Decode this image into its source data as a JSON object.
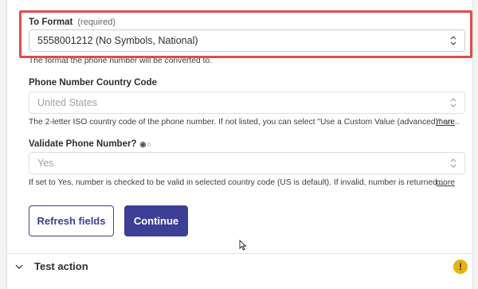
{
  "to_format": {
    "label": "To Format",
    "required": "(required)",
    "value": "5558001212 (No Symbols, National)",
    "help": "The format the phone number will be converted to."
  },
  "country_code": {
    "label": "Phone Number Country Code",
    "value": "United States",
    "help": "The 2-letter ISO country code of the phone number. If not listed, you can select \"Use a Custom Value (advanced)\" an...",
    "more": "more"
  },
  "validate": {
    "label": "Validate Phone Number?",
    "icon": "radio-toggle-icon",
    "value": "Yes",
    "help": "If set to Yes, number is checked to be valid in selected country code (US is default). If invalid, number is returned...",
    "more": "more"
  },
  "buttons": {
    "refresh": "Refresh fields",
    "continue": "Continue"
  },
  "test_action": {
    "label": "Test action",
    "warning_icon": "!"
  },
  "colors": {
    "primary": "#3d3f96",
    "highlight": "#e24b4b",
    "warning": "#e3b312"
  }
}
